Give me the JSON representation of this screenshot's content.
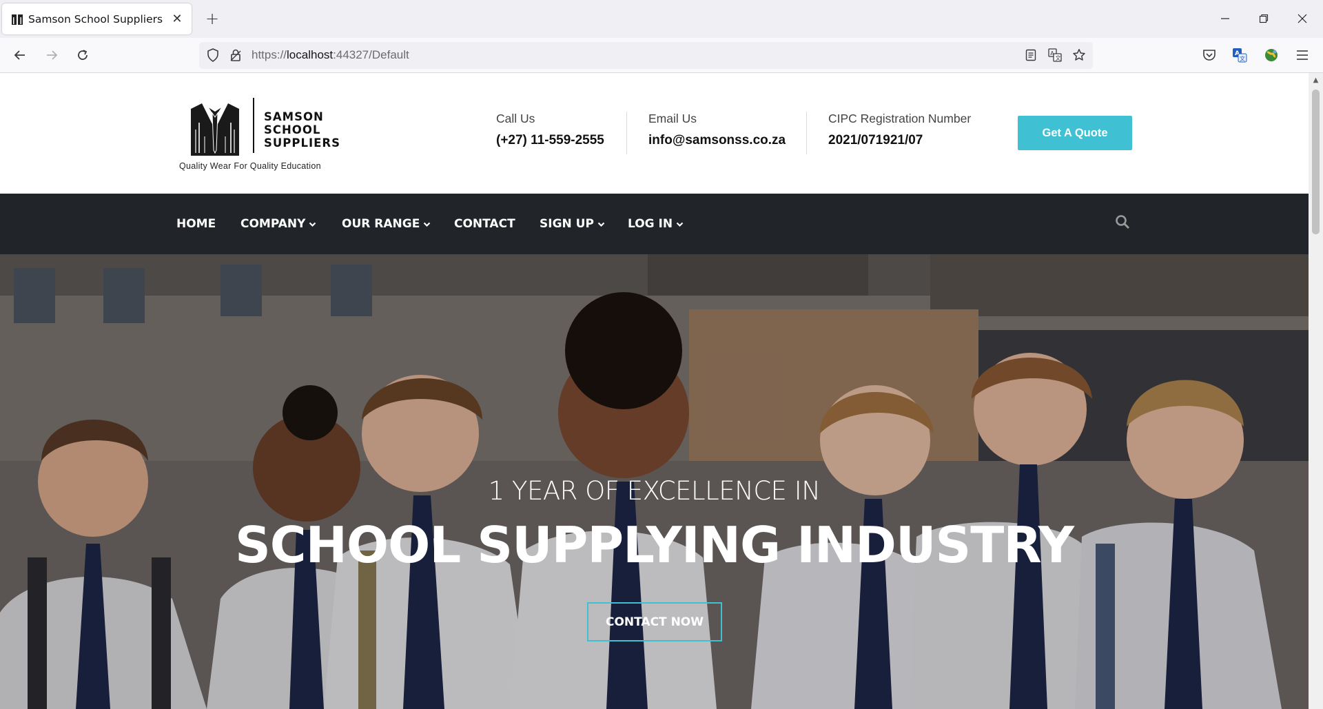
{
  "browser": {
    "tab_title": "Samson School Suppliers",
    "url_scheme": "https://",
    "url_host": "localhost",
    "url_rest": ":44327/Default"
  },
  "header": {
    "logo": {
      "name_line1": "SAMSON",
      "name_line2": "SCHOOL",
      "name_line3": "SUPPLIERS",
      "tagline": "Quality Wear For Quality Education"
    },
    "call": {
      "label": "Call Us",
      "value": "(+27) 11-559-2555"
    },
    "email": {
      "label": "Email Us",
      "value": "info@samsonss.co.za"
    },
    "cipc": {
      "label": "CIPC Registration Number",
      "value": "2021/071921/07"
    },
    "quote_button": "Get A Quote",
    "accent_color": "#3fc1d3"
  },
  "nav": {
    "items": [
      {
        "label": "HOME",
        "dropdown": false
      },
      {
        "label": "COMPANY",
        "dropdown": true
      },
      {
        "label": "OUR RANGE",
        "dropdown": true
      },
      {
        "label": "CONTACT",
        "dropdown": false
      },
      {
        "label": "SIGN UP",
        "dropdown": true
      },
      {
        "label": "LOG IN",
        "dropdown": true
      }
    ],
    "background": "#212529"
  },
  "hero": {
    "subtitle": "1 YEAR OF EXCELLENCE IN",
    "title": "SCHOOL SUPPLYING INDUSTRY",
    "button": "CONTACT NOW"
  }
}
